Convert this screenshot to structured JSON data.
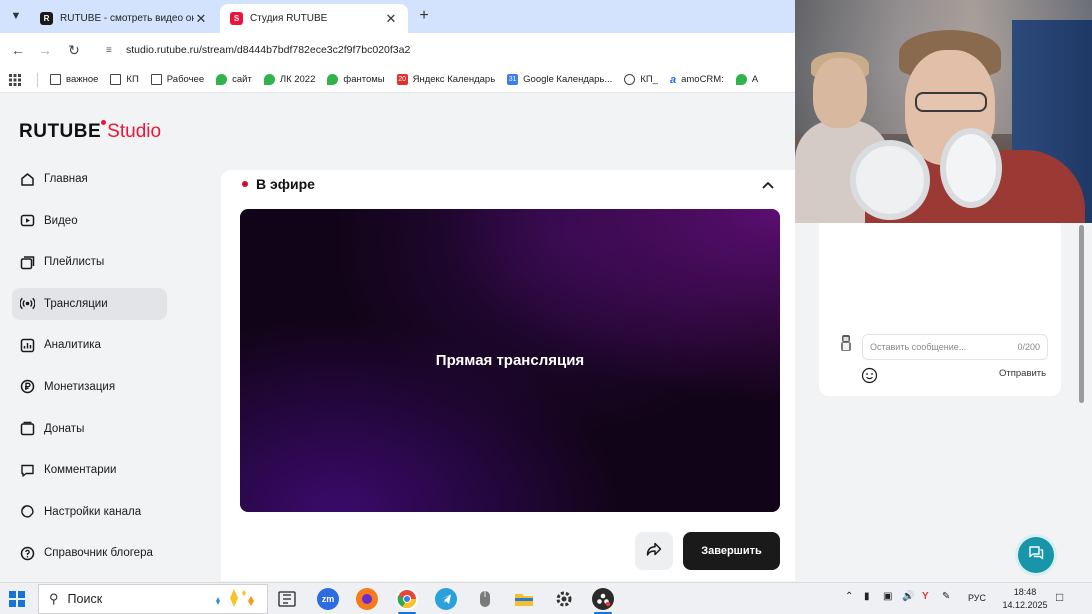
{
  "browser": {
    "tabs": [
      {
        "label": "RUTUBE - смотреть видео онлайн",
        "active": false
      },
      {
        "label": "Студия RUTUBE",
        "active": true
      }
    ],
    "url": "studio.rutube.ru/stream/d8444b7bdf782ece3c2f9f7bc020f3a2",
    "bookmarks": [
      {
        "label": "важное",
        "icon": "folder-icon"
      },
      {
        "label": "КП",
        "icon": "folder-icon"
      },
      {
        "label": "Рабочее",
        "icon": "folder-icon"
      },
      {
        "label": "сайт",
        "icon": "green-leaf-icon"
      },
      {
        "label": "ЛК 2022",
        "icon": "green-leaf-icon"
      },
      {
        "label": "фантомы",
        "icon": "green-leaf-icon"
      },
      {
        "label": "Яндекс Календарь",
        "icon": "yandex-calendar-icon"
      },
      {
        "label": "Google Календарь...",
        "icon": "google-calendar-icon"
      },
      {
        "label": "КП_",
        "icon": "globe-icon"
      },
      {
        "label": "amoCRM:",
        "icon": "amocrm-icon"
      },
      {
        "label": "А",
        "icon": "green-leaf-icon"
      }
    ]
  },
  "logo": {
    "brand": "RUTUBE",
    "product": "Studio"
  },
  "sidebar": {
    "items": [
      {
        "label": "Главная",
        "icon": "home-icon",
        "active": false
      },
      {
        "label": "Видео",
        "icon": "video-icon",
        "active": false
      },
      {
        "label": "Плейлисты",
        "icon": "playlist-icon",
        "active": false
      },
      {
        "label": "Трансляции",
        "icon": "broadcast-icon",
        "active": true
      },
      {
        "label": "Аналитика",
        "icon": "analytics-icon",
        "active": false
      },
      {
        "label": "Монетизация",
        "icon": "ruble-icon",
        "active": false
      },
      {
        "label": "Донаты",
        "icon": "donate-icon",
        "active": false
      },
      {
        "label": "Комментарии",
        "icon": "comments-icon",
        "active": false
      },
      {
        "label": "Настройки канала",
        "icon": "settings-icon",
        "active": false
      },
      {
        "label": "Справочник блогера",
        "icon": "help-book-icon",
        "active": false
      }
    ]
  },
  "stream": {
    "status": "В эфире",
    "player_text": "Прямая трансляция",
    "finish_label": "Завершить"
  },
  "chat": {
    "placeholder": "Оставить сообщение...",
    "counter": "0/200",
    "send_label": "Отправить"
  },
  "taskbar": {
    "search_label": "Поиск",
    "apps": [
      "task-view-icon",
      "zoom-icon",
      "firefox-icon",
      "chrome-icon",
      "telegram-icon",
      "mouse-app-icon",
      "file-explorer-icon",
      "settings-app-icon",
      "obs-icon"
    ],
    "language": "РУС",
    "time": "18:48",
    "date": "14.12.2025"
  },
  "colors": {
    "accent": "#ed143b",
    "live_dot": "#d20a2e",
    "finish_button": "#1a1a1a",
    "help_button": "#1795a9"
  }
}
